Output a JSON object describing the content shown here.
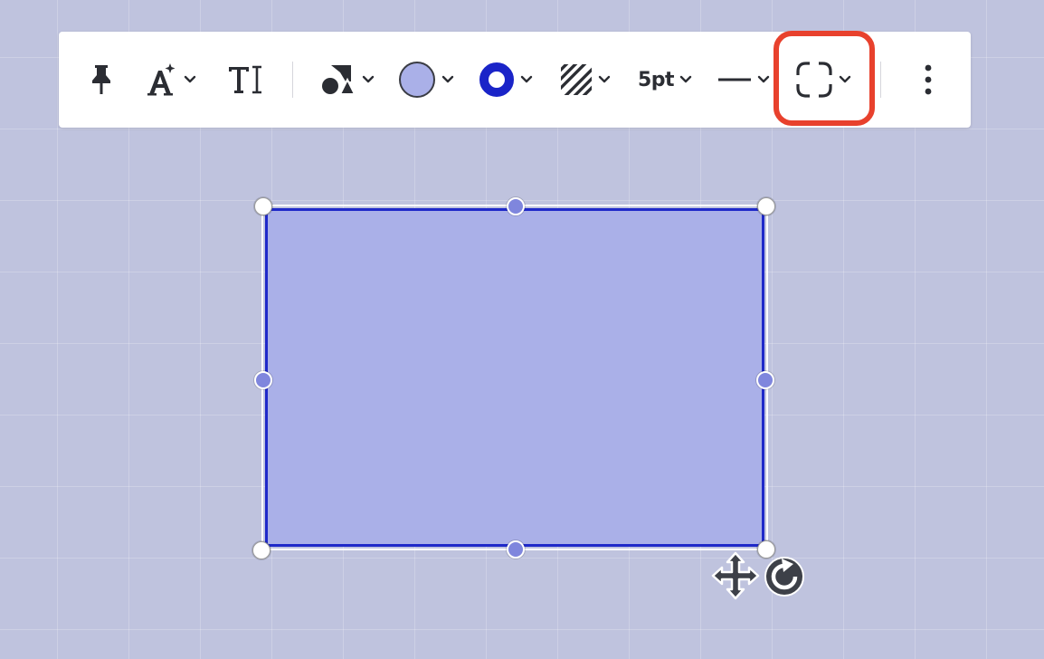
{
  "toolbar": {
    "items": [
      {
        "name": "pin-button",
        "icon": "pin-icon"
      },
      {
        "name": "ai-text-style-button",
        "icon": "sparkle-text-icon"
      },
      {
        "name": "text-button",
        "icon": "text-cursor-icon"
      },
      {
        "name": "shape-type-button",
        "icon": "shapes-icon"
      },
      {
        "name": "fill-color-button",
        "icon": "fill-swatch-icon"
      },
      {
        "name": "border-color-button",
        "icon": "ring-icon"
      },
      {
        "name": "fill-pattern-button",
        "icon": "hatch-icon"
      },
      {
        "name": "stroke-width-button",
        "label": "5pt"
      },
      {
        "name": "line-style-button",
        "icon": "solid-line-icon"
      },
      {
        "name": "corner-style-button",
        "icon": "rounded-corner-icon",
        "highlighted": true
      },
      {
        "name": "more-options-button",
        "icon": "vertical-dots-icon"
      }
    ],
    "stroke_width_label": "5pt"
  },
  "colors": {
    "canvas_bg": "#bfc3de",
    "shape_fill": "#aab0e8",
    "shape_border": "#1f29c9",
    "ring_color": "#1a24c8",
    "highlight": "#e8412d",
    "handle_mid": "#7f86dd"
  },
  "canvas": {
    "selected_shape": {
      "type": "rectangle"
    }
  }
}
